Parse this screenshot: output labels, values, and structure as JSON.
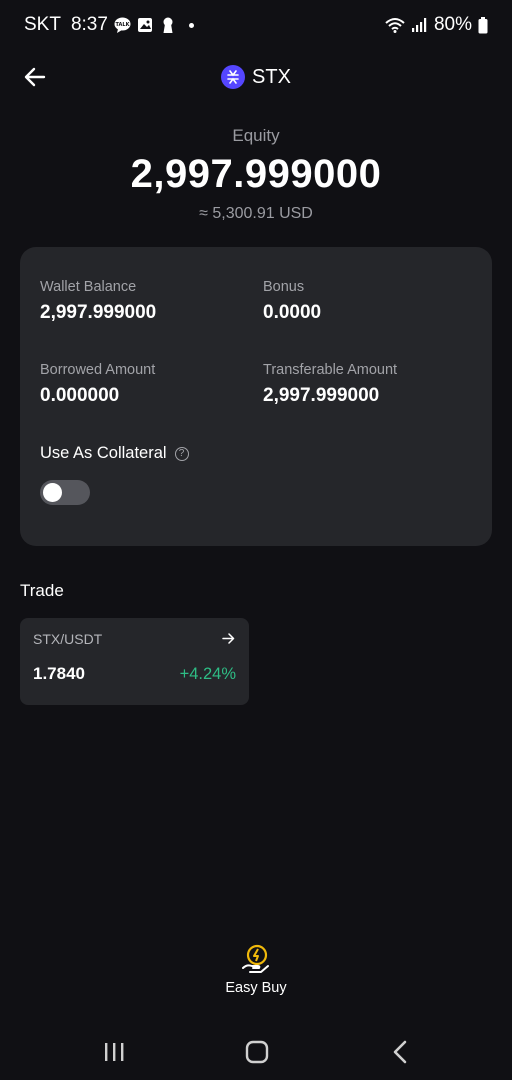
{
  "status_bar": {
    "carrier": "SKT",
    "time": "8:37",
    "battery": "80%",
    "icons": [
      "talk-icon",
      "gallery-icon",
      "keyhole-icon",
      "dot-icon",
      "wifi-icon",
      "signal-icon",
      "battery-icon"
    ]
  },
  "header": {
    "title": "STX",
    "back_icon": "back-arrow-icon",
    "coin_icon": "stx-logo-icon",
    "coin_color": "#5546ff"
  },
  "equity": {
    "label": "Equity",
    "value": "2,997.999000",
    "usd": "≈ 5,300.91 USD"
  },
  "balances": {
    "wallet_balance": {
      "label": "Wallet Balance",
      "value": "2,997.999000"
    },
    "bonus": {
      "label": "Bonus",
      "value": "0.0000"
    },
    "borrowed_amount": {
      "label": "Borrowed Amount",
      "value": "0.000000"
    },
    "transferable_amount": {
      "label": "Transferable Amount",
      "value": "2,997.999000"
    }
  },
  "collateral": {
    "label": "Use As Collateral",
    "help_icon": "help-icon",
    "enabled": false
  },
  "trade": {
    "title": "Trade",
    "pair": "STX/USDT",
    "price": "1.7840",
    "change": "+4.24%",
    "change_color": "#2ebd85"
  },
  "easy_buy": {
    "label": "Easy Buy",
    "icon": "easy-buy-icon",
    "icon_color": "#f0b90b"
  },
  "nav": {
    "icons": [
      "recent-apps-icon",
      "home-icon",
      "back-icon"
    ]
  }
}
